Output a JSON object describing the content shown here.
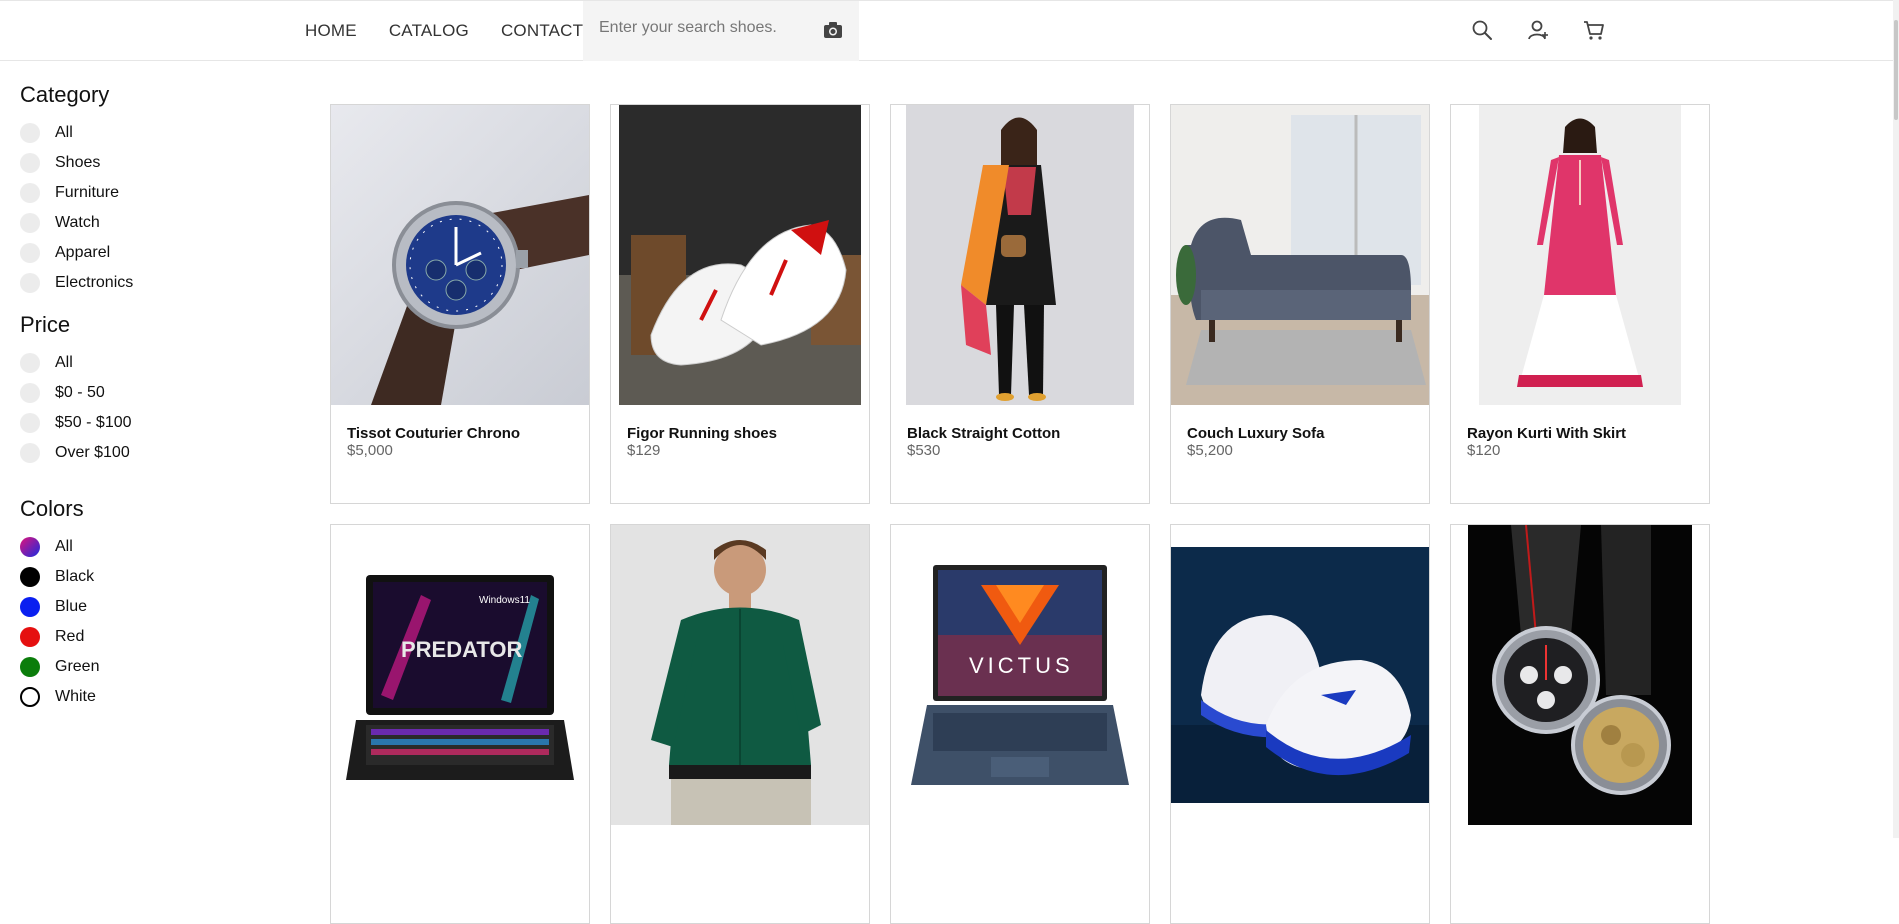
{
  "nav": {
    "items": [
      "HOME",
      "CATALOG",
      "CONTACT"
    ]
  },
  "search": {
    "placeholder": "Enter your search shoes."
  },
  "icons": {
    "camera": "camera-icon",
    "search": "search-icon",
    "user": "user-icon",
    "cart": "cart-icon"
  },
  "sidebar": {
    "category": {
      "title": "Category",
      "options": [
        "All",
        "Shoes",
        "Furniture",
        "Watch",
        "Apparel",
        "Electronics"
      ]
    },
    "price": {
      "title": "Price",
      "options": [
        "All",
        "$0 - 50",
        "$50 - $100",
        "Over $100"
      ]
    },
    "colors": {
      "title": "Colors",
      "options": [
        {
          "label": "All",
          "color": "gradient"
        },
        {
          "label": "Black",
          "color": "#000000"
        },
        {
          "label": "Blue",
          "color": "#0a1ff0"
        },
        {
          "label": "Red",
          "color": "#e51010"
        },
        {
          "label": "Green",
          "color": "#0b7d0b"
        },
        {
          "label": "White",
          "color": "#ffffff"
        }
      ]
    }
  },
  "products": [
    {
      "name": "Tissot Couturier Chrono",
      "price": "$5,000",
      "image": "watch-image"
    },
    {
      "name": "Figor Running shoes",
      "price": "$129",
      "image": "shoes-image"
    },
    {
      "name": "Black Straight Cotton",
      "price": "$530",
      "image": "apparel-image"
    },
    {
      "name": "Couch Luxury Sofa",
      "price": "$5,200",
      "image": "sofa-image"
    },
    {
      "name": "Rayon Kurti With Skirt",
      "price": "$120",
      "image": "kurti-image"
    },
    {
      "name": "",
      "price": "",
      "image": "laptop-image",
      "screen_text": [
        "Windows11",
        "PREDATOR"
      ]
    },
    {
      "name": "",
      "price": "",
      "image": "shirt-image"
    },
    {
      "name": "",
      "price": "",
      "image": "laptop-image",
      "screen_text": [
        "VICTUS"
      ]
    },
    {
      "name": "",
      "price": "",
      "image": "sneakers-image"
    },
    {
      "name": "",
      "price": "",
      "image": "watch-image"
    }
  ]
}
